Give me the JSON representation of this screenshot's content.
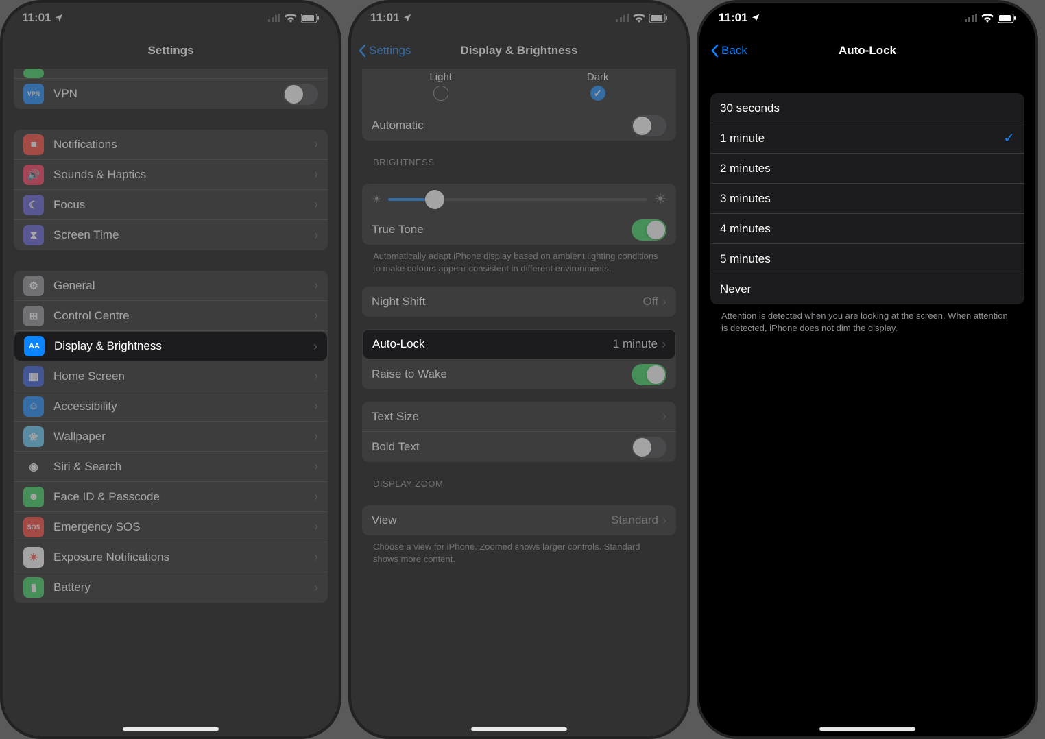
{
  "status": {
    "time": "11:01"
  },
  "p1": {
    "title": "Settings",
    "group1": [
      {
        "key": "vpn",
        "label": "VPN",
        "icon_bg": "#0a84ff",
        "glyph": "VPN",
        "glyph_size": "9px",
        "toggle": false
      }
    ],
    "group2": [
      {
        "key": "notifications",
        "label": "Notifications",
        "icon_bg": "#ff3b30",
        "glyph": "■"
      },
      {
        "key": "sounds",
        "label": "Sounds & Haptics",
        "icon_bg": "#ff2d55",
        "glyph": "🔊"
      },
      {
        "key": "focus",
        "label": "Focus",
        "icon_bg": "#5856d6",
        "glyph": "☾"
      },
      {
        "key": "screentime",
        "label": "Screen Time",
        "icon_bg": "#5856d6",
        "glyph": "⧗"
      }
    ],
    "group3": [
      {
        "key": "general",
        "label": "General",
        "icon_bg": "#8e8e93",
        "glyph": "⚙"
      },
      {
        "key": "control",
        "label": "Control Centre",
        "icon_bg": "#8e8e93",
        "glyph": "⊞"
      },
      {
        "key": "display",
        "label": "Display & Brightness",
        "icon_bg": "#0a84ff",
        "glyph": "AA",
        "glyph_size": "11px"
      },
      {
        "key": "home",
        "label": "Home Screen",
        "icon_bg": "#2850d9",
        "glyph": "▦"
      },
      {
        "key": "accessibility",
        "label": "Accessibility",
        "icon_bg": "#0a84ff",
        "glyph": "☺"
      },
      {
        "key": "wallpaper",
        "label": "Wallpaper",
        "icon_bg": "#5ac8fa",
        "glyph": "❀"
      },
      {
        "key": "siri",
        "label": "Siri & Search",
        "icon_bg": "#1c1c1e",
        "glyph": "◉"
      },
      {
        "key": "faceid",
        "label": "Face ID & Passcode",
        "icon_bg": "#30d158",
        "glyph": "☻"
      },
      {
        "key": "sos",
        "label": "Emergency SOS",
        "icon_bg": "#ff3b30",
        "glyph": "SOS",
        "glyph_size": "9px"
      },
      {
        "key": "exposure",
        "label": "Exposure Notifications",
        "icon_bg": "#fff",
        "glyph": "✳",
        "glyph_color": "#ff3b30"
      },
      {
        "key": "battery",
        "label": "Battery",
        "icon_bg": "#30d158",
        "glyph": "▮"
      }
    ],
    "highlight_key": "display"
  },
  "p2": {
    "back": "Settings",
    "title": "Display & Brightness",
    "appearance": {
      "light": "Light",
      "dark": "Dark",
      "selected": "dark"
    },
    "automatic_label": "Automatic",
    "automatic_on": false,
    "brightness_header": "BRIGHTNESS",
    "truetone_label": "True Tone",
    "truetone_on": true,
    "truetone_footer": "Automatically adapt iPhone display based on ambient lighting conditions to make colours appear consistent in different environments.",
    "nightshift_label": "Night Shift",
    "nightshift_value": "Off",
    "autolock_label": "Auto-Lock",
    "autolock_value": "1 minute",
    "raise_label": "Raise to Wake",
    "raise_on": true,
    "textsize_label": "Text Size",
    "bold_label": "Bold Text",
    "bold_on": false,
    "zoom_header": "DISPLAY ZOOM",
    "view_label": "View",
    "view_value": "Standard",
    "zoom_footer": "Choose a view for iPhone. Zoomed shows larger controls. Standard shows more content.",
    "highlight_key": "autolock"
  },
  "p3": {
    "back": "Back",
    "title": "Auto-Lock",
    "options": [
      "30 seconds",
      "1 minute",
      "2 minutes",
      "3 minutes",
      "4 minutes",
      "5 minutes",
      "Never"
    ],
    "selected": "1 minute",
    "footer": "Attention is detected when you are looking at the screen. When attention is detected, iPhone does not dim the display."
  }
}
